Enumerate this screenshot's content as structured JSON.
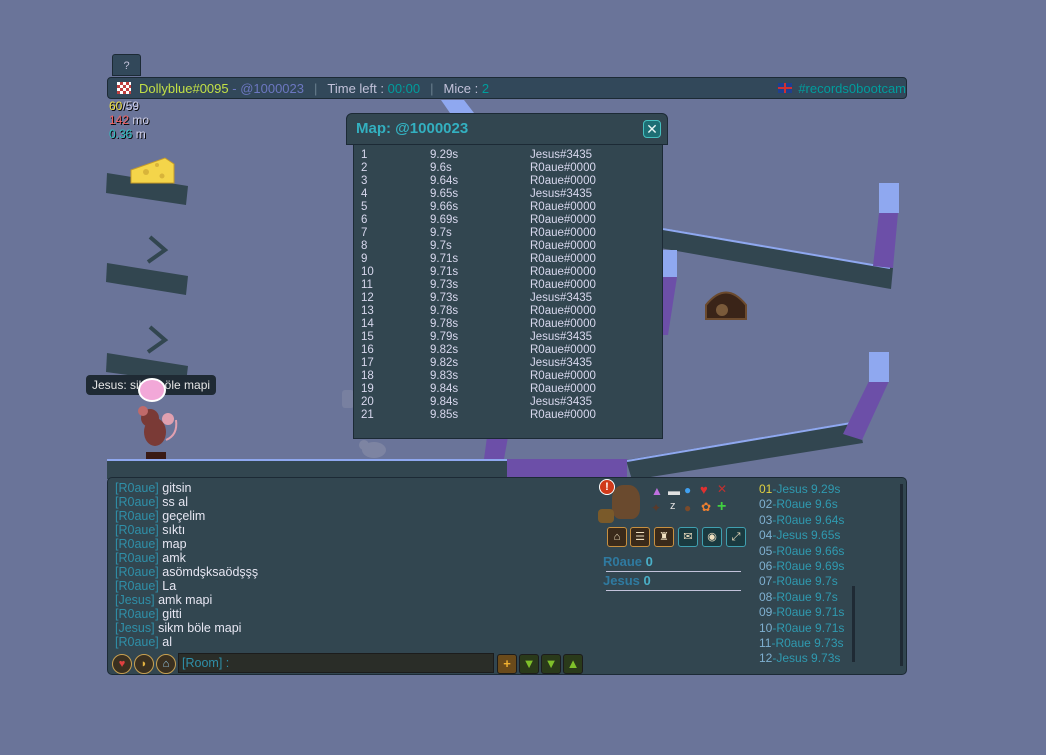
{
  "help_label": "?",
  "topbar": {
    "player": "Dollyblue#0095",
    "dash": " - ",
    "map_code": "@1000023",
    "sep1": "|",
    "time_label": "Time left : ",
    "time_value": "00:00",
    "sep2": "|",
    "mice_label": "Mice : ",
    "mice_value": "2",
    "room": "#records0bootcam"
  },
  "stats": {
    "cheese_cur": "60",
    "cheese_max": "/59",
    "mo_value": "142",
    "mo_label": " mo",
    "m_value": "0.36",
    "m_label": " m"
  },
  "speech": "Jesus: sikm böle mapi",
  "modal": {
    "title": "Map: @1000023",
    "close": "✕",
    "records": [
      {
        "rank": "1",
        "time": "9.29s",
        "player": "Jesus#3435"
      },
      {
        "rank": "2",
        "time": "9.6s",
        "player": "R0aue#0000"
      },
      {
        "rank": "3",
        "time": "9.64s",
        "player": "R0aue#0000"
      },
      {
        "rank": "4",
        "time": "9.65s",
        "player": "Jesus#3435"
      },
      {
        "rank": "5",
        "time": "9.66s",
        "player": "R0aue#0000"
      },
      {
        "rank": "6",
        "time": "9.69s",
        "player": "R0aue#0000"
      },
      {
        "rank": "7",
        "time": "9.7s",
        "player": "R0aue#0000"
      },
      {
        "rank": "8",
        "time": "9.7s",
        "player": "R0aue#0000"
      },
      {
        "rank": "9",
        "time": "9.71s",
        "player": "R0aue#0000"
      },
      {
        "rank": "10",
        "time": "9.71s",
        "player": "R0aue#0000"
      },
      {
        "rank": "11",
        "time": "9.73s",
        "player": "R0aue#0000"
      },
      {
        "rank": "12",
        "time": "9.73s",
        "player": "Jesus#3435"
      },
      {
        "rank": "13",
        "time": "9.78s",
        "player": "R0aue#0000"
      },
      {
        "rank": "14",
        "time": "9.78s",
        "player": "R0aue#0000"
      },
      {
        "rank": "15",
        "time": "9.79s",
        "player": "Jesus#3435"
      },
      {
        "rank": "16",
        "time": "9.82s",
        "player": "R0aue#0000"
      },
      {
        "rank": "17",
        "time": "9.82s",
        "player": "Jesus#3435"
      },
      {
        "rank": "18",
        "time": "9.83s",
        "player": "R0aue#0000"
      },
      {
        "rank": "19",
        "time": "9.84s",
        "player": "R0aue#0000"
      },
      {
        "rank": "20",
        "time": "9.84s",
        "player": "Jesus#3435"
      },
      {
        "rank": "21",
        "time": "9.85s",
        "player": "R0aue#0000"
      }
    ]
  },
  "chat": [
    {
      "who": "[R0aue]",
      "msg": "gitsin"
    },
    {
      "who": "[R0aue]",
      "msg": "ss al"
    },
    {
      "who": "[R0aue]",
      "msg": "geçelim"
    },
    {
      "who": "[R0aue]",
      "msg": "sıktı"
    },
    {
      "who": "[R0aue]",
      "msg": "map"
    },
    {
      "who": "[R0aue]",
      "msg": "amk"
    },
    {
      "who": "[R0aue]",
      "msg": "asömdşksaödşşş"
    },
    {
      "who": "[R0aue]",
      "msg": "La"
    },
    {
      "who": "[Jesus]",
      "msg": "amk mapi"
    },
    {
      "who": "[R0aue]",
      "msg": "gitti"
    },
    {
      "who": "[Jesus]",
      "msg": "sikm böle mapi"
    },
    {
      "who": "[R0aue]",
      "msg": "al"
    }
  ],
  "chat_input": "[Room] :",
  "scores": [
    {
      "name": "R0aue",
      "value": "0"
    },
    {
      "name": "Jesus",
      "value": "0"
    }
  ],
  "ranking": [
    {
      "num": "01",
      "name": "-Jesus 9.29s"
    },
    {
      "num": "02",
      "name": "-R0aue 9.6s"
    },
    {
      "num": "03",
      "name": "-R0aue 9.64s"
    },
    {
      "num": "04",
      "name": "-Jesus 9.65s"
    },
    {
      "num": "05",
      "name": "-R0aue 9.66s"
    },
    {
      "num": "06",
      "name": "-R0aue 9.69s"
    },
    {
      "num": "07",
      "name": "-R0aue 9.7s"
    },
    {
      "num": "08",
      "name": "-R0aue 9.7s"
    },
    {
      "num": "09",
      "name": "-R0aue 9.71s"
    },
    {
      "num": "10",
      "name": "-R0aue 9.71s"
    },
    {
      "num": "11",
      "name": "-R0aue 9.73s"
    },
    {
      "num": "12",
      "name": "-Jesus 9.73s"
    }
  ],
  "colors": {
    "background": "#6a7499",
    "panel": "#324650",
    "accent_cyan": "#009d9d",
    "player_yellow": "#c2e046",
    "platform_purple": "#6c4fa8",
    "platform_blue": "#8fa8f0"
  },
  "icons": {
    "map_flag": "checkered-flag-icon",
    "room_flag": "uk-flag-icon",
    "cheese": "cheese-icon",
    "mouse_hole": "mouse-hole-icon"
  }
}
